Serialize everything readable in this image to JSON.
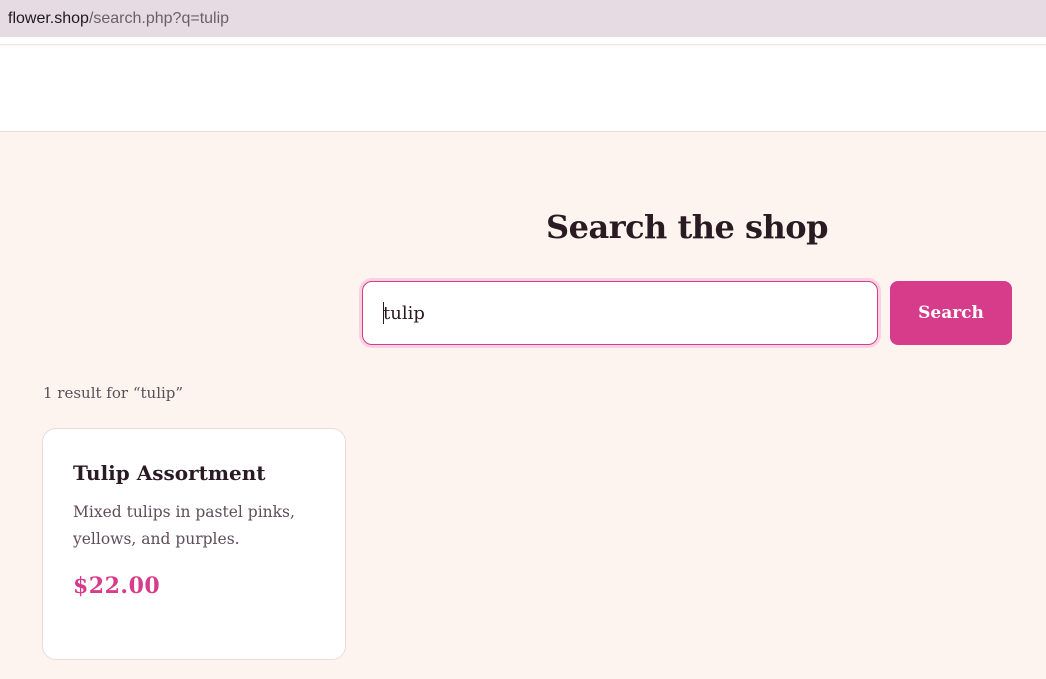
{
  "browser": {
    "url_host": "flower.shop",
    "url_path": "/search.php?q=tulip"
  },
  "page": {
    "title": "Search the shop"
  },
  "search": {
    "value": "tulip",
    "button_label": "Search"
  },
  "results": {
    "count_text": "1 result for “tulip”",
    "items": [
      {
        "name": "Tulip Assortment",
        "description": "Mixed tulips in pastel pinks, yellows, and purples.",
        "price": "$22.00"
      }
    ]
  },
  "colors": {
    "accent": "#d63c8a",
    "background": "#fdf4f0",
    "heading": "#2a1a22",
    "muted": "#5e4e58"
  }
}
